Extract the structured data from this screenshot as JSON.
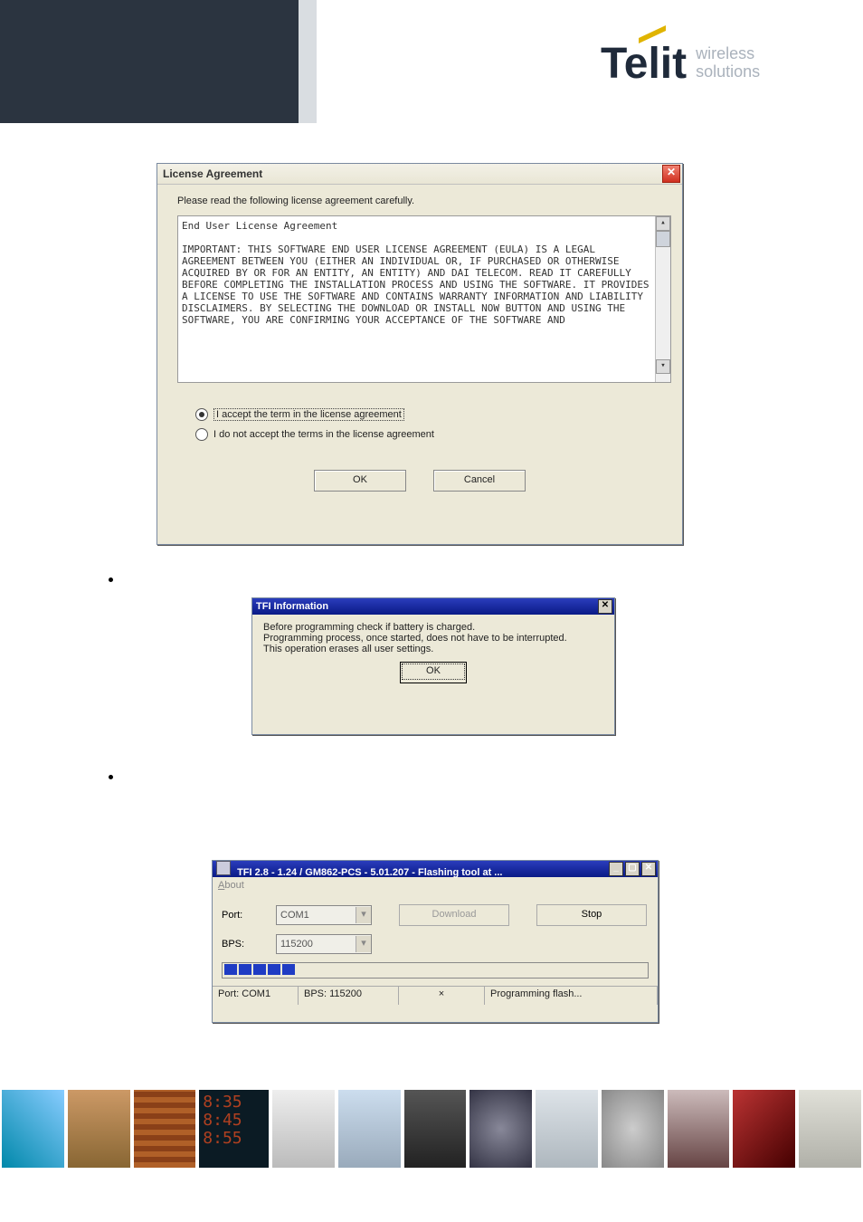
{
  "brand": {
    "name": "Telit",
    "tag1": "wireless",
    "tag2": "solutions"
  },
  "license_dialog": {
    "title": "License Agreement",
    "instruction": "Please read the following license agreement carefully.",
    "eula_heading": "End User License Agreement",
    "eula_body": "IMPORTANT: THIS SOFTWARE END USER LICENSE AGREEMENT (EULA) IS A LEGAL AGREEMENT BETWEEN YOU (EITHER AN INDIVIDUAL OR, IF PURCHASED OR OTHERWISE ACQUIRED BY OR FOR AN ENTITY, AN ENTITY) AND DAI TELECOM. READ IT CAREFULLY BEFORE COMPLETING THE INSTALLATION PROCESS AND USING THE SOFTWARE. IT PROVIDES A LICENSE TO USE THE SOFTWARE AND CONTAINS WARRANTY INFORMATION AND LIABILITY DISCLAIMERS. BY SELECTING THE DOWNLOAD OR INSTALL NOW BUTTON AND USING THE SOFTWARE, YOU ARE CONFIRMING YOUR ACCEPTANCE OF THE SOFTWARE AND",
    "accept_label": "I accept the term in the license agreement",
    "reject_label": "I do not accept the terms in the license agreement",
    "ok": "OK",
    "cancel": "Cancel"
  },
  "info_dialog": {
    "title": "TFI Information",
    "line1": "Before programming check if battery is charged.",
    "line2": "Programming process, once started, does not have to be interrupted.",
    "line3": "This operation erases all user settings.",
    "ok": "OK"
  },
  "flash_dialog": {
    "title": "TFI 2.8 - 1.24 / GM862-PCS - 5.01.207 - Flashing tool at ...",
    "menu_about": "About",
    "port_label": "Port:",
    "port_value": "COM1",
    "bps_label": "BPS:",
    "bps_value": "115200",
    "download": "Download",
    "stop": "Stop",
    "status_port": "Port: COM1",
    "status_bps": "BPS: 115200",
    "status_mid": "×",
    "status_msg": "Programming flash..."
  },
  "clock": {
    "t1": "8:35",
    "t2": "8:45",
    "t3": "8:55"
  }
}
